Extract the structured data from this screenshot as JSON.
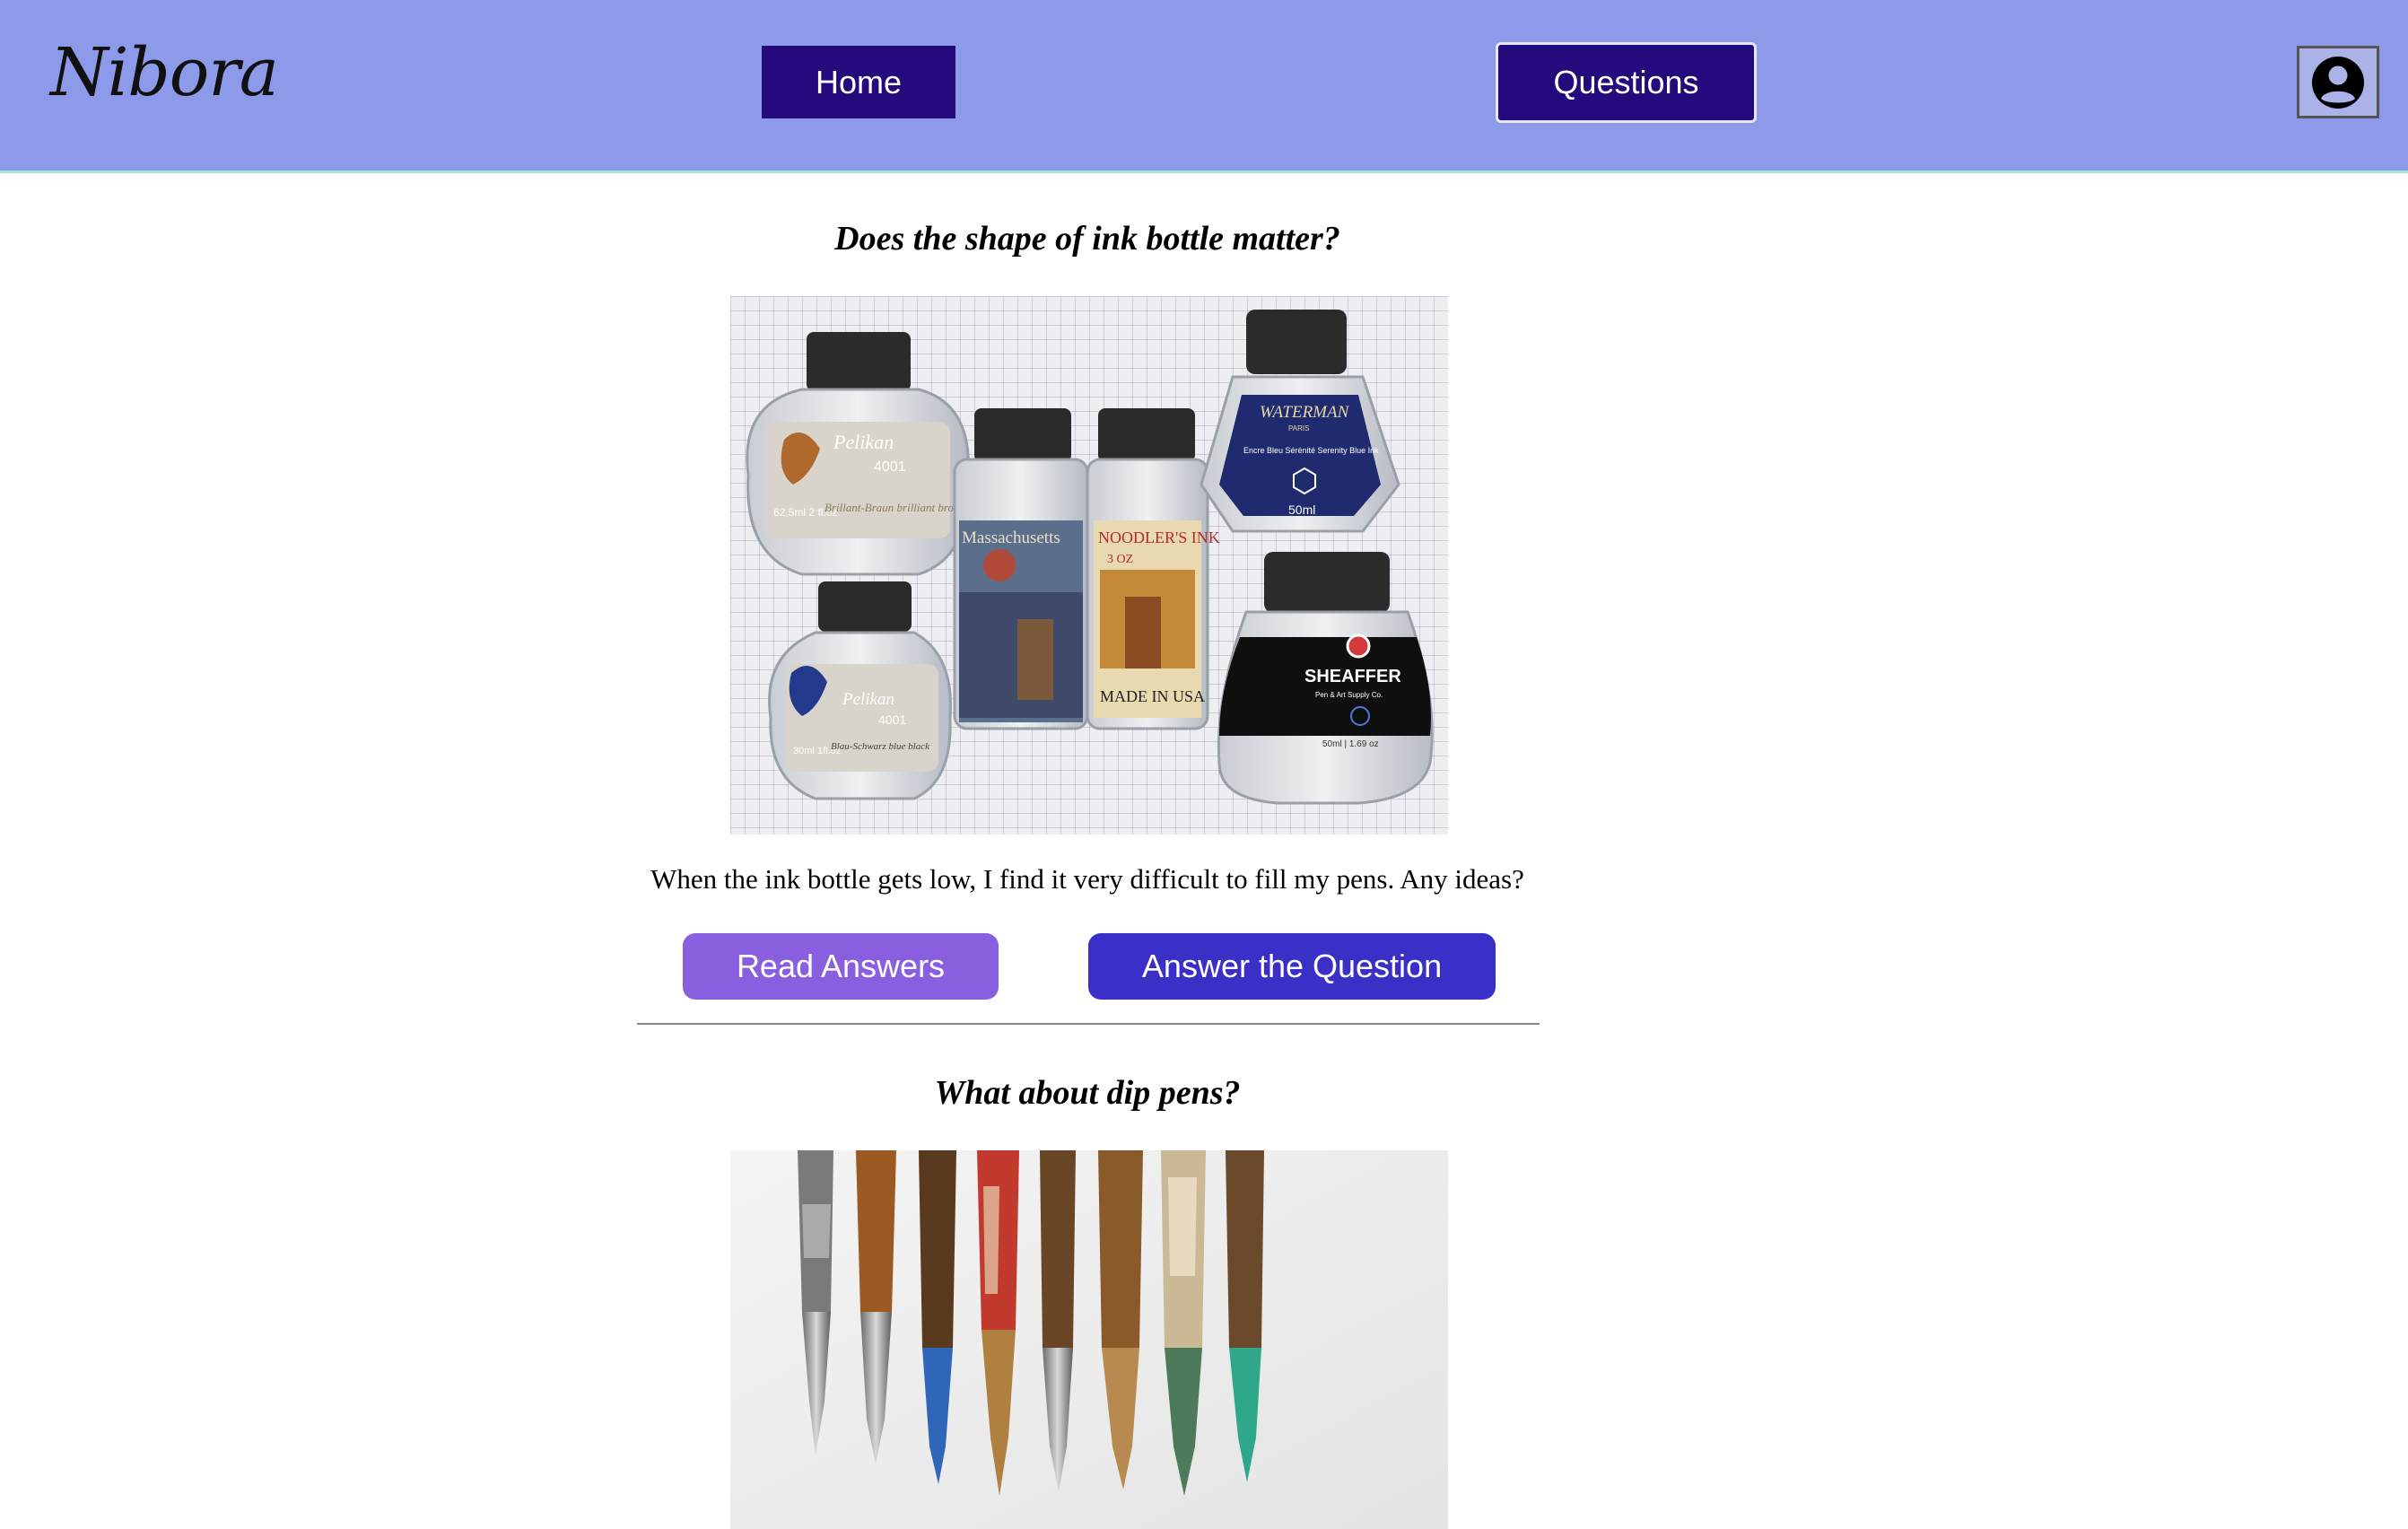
{
  "header": {
    "logo": "Nibora",
    "nav": {
      "home_label": "Home",
      "questions_label": "Questions"
    },
    "avatar_icon": "user-circle-icon"
  },
  "colors": {
    "header_bg": "#8c9ae9",
    "nav_button_bg": "#240a7c",
    "read_answers_bg": "#8a5fdf",
    "answer_question_bg": "#3a30c8"
  },
  "questions": [
    {
      "title": "Does the shape of ink bottle matter?",
      "image": "ink-bottles-photo",
      "image_labels": {
        "pelikan_top": "Pelikan",
        "pelikan_top_model": "4001",
        "pelikan_top_volume": "62,5ml 2 fl.oz",
        "pelikan_top_color": "Brillant-Braun brilliant brown",
        "pelikan_bottom": "Pelikan",
        "pelikan_bottom_model": "4001",
        "pelikan_bottom_volume": "30ml 1fl.oz",
        "pelikan_bottom_color": "Blau-Schwarz blue black",
        "massachusetts": "Massachusetts",
        "noodlers": "NOODLER'S INK",
        "noodlers_size": "3 OZ",
        "noodlers_made": "MADE IN USA",
        "waterman": "WATERMAN",
        "waterman_sub": "PARIS",
        "waterman_color": "Encre Bleu Sérénité Serenity Blue Ink",
        "waterman_volume": "50ml",
        "sheaffer": "SHEAFFER",
        "sheaffer_sub": "Pen & Art Supply Co.",
        "sheaffer_volume": "50ml | 1.69 oz"
      },
      "body": "When the ink bottle gets low, I find it very difficult to fill my pens. Any ideas?",
      "read_label": "Read Answers",
      "answer_label": "Answer the Question"
    },
    {
      "title": "What about dip pens?",
      "image": "dip-pens-photo"
    }
  ]
}
